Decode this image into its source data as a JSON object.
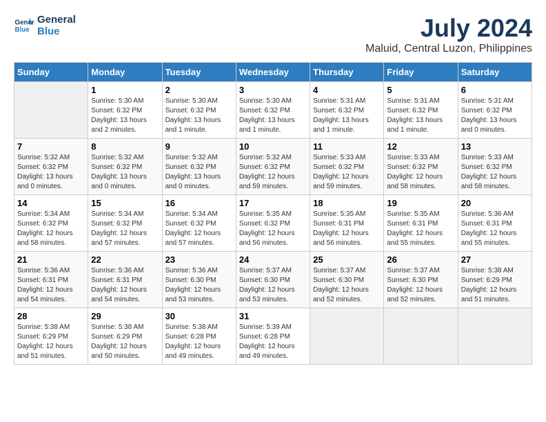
{
  "logo": {
    "line1": "General",
    "line2": "Blue"
  },
  "title": "July 2024",
  "subtitle": "Maluid, Central Luzon, Philippines",
  "days_of_week": [
    "Sunday",
    "Monday",
    "Tuesday",
    "Wednesday",
    "Thursday",
    "Friday",
    "Saturday"
  ],
  "weeks": [
    [
      {
        "day": "",
        "info": ""
      },
      {
        "day": "1",
        "info": "Sunrise: 5:30 AM\nSunset: 6:32 PM\nDaylight: 13 hours\nand 2 minutes."
      },
      {
        "day": "2",
        "info": "Sunrise: 5:30 AM\nSunset: 6:32 PM\nDaylight: 13 hours\nand 1 minute."
      },
      {
        "day": "3",
        "info": "Sunrise: 5:30 AM\nSunset: 6:32 PM\nDaylight: 13 hours\nand 1 minute."
      },
      {
        "day": "4",
        "info": "Sunrise: 5:31 AM\nSunset: 6:32 PM\nDaylight: 13 hours\nand 1 minute."
      },
      {
        "day": "5",
        "info": "Sunrise: 5:31 AM\nSunset: 6:32 PM\nDaylight: 13 hours\nand 1 minute."
      },
      {
        "day": "6",
        "info": "Sunrise: 5:31 AM\nSunset: 6:32 PM\nDaylight: 13 hours\nand 0 minutes."
      }
    ],
    [
      {
        "day": "7",
        "info": "Sunrise: 5:32 AM\nSunset: 6:32 PM\nDaylight: 13 hours\nand 0 minutes."
      },
      {
        "day": "8",
        "info": "Sunrise: 5:32 AM\nSunset: 6:32 PM\nDaylight: 13 hours\nand 0 minutes."
      },
      {
        "day": "9",
        "info": "Sunrise: 5:32 AM\nSunset: 6:32 PM\nDaylight: 13 hours\nand 0 minutes."
      },
      {
        "day": "10",
        "info": "Sunrise: 5:32 AM\nSunset: 6:32 PM\nDaylight: 12 hours\nand 59 minutes."
      },
      {
        "day": "11",
        "info": "Sunrise: 5:33 AM\nSunset: 6:32 PM\nDaylight: 12 hours\nand 59 minutes."
      },
      {
        "day": "12",
        "info": "Sunrise: 5:33 AM\nSunset: 6:32 PM\nDaylight: 12 hours\nand 58 minutes."
      },
      {
        "day": "13",
        "info": "Sunrise: 5:33 AM\nSunset: 6:32 PM\nDaylight: 12 hours\nand 58 minutes."
      }
    ],
    [
      {
        "day": "14",
        "info": "Sunrise: 5:34 AM\nSunset: 6:32 PM\nDaylight: 12 hours\nand 58 minutes."
      },
      {
        "day": "15",
        "info": "Sunrise: 5:34 AM\nSunset: 6:32 PM\nDaylight: 12 hours\nand 57 minutes."
      },
      {
        "day": "16",
        "info": "Sunrise: 5:34 AM\nSunset: 6:32 PM\nDaylight: 12 hours\nand 57 minutes."
      },
      {
        "day": "17",
        "info": "Sunrise: 5:35 AM\nSunset: 6:32 PM\nDaylight: 12 hours\nand 56 minutes."
      },
      {
        "day": "18",
        "info": "Sunrise: 5:35 AM\nSunset: 6:31 PM\nDaylight: 12 hours\nand 56 minutes."
      },
      {
        "day": "19",
        "info": "Sunrise: 5:35 AM\nSunset: 6:31 PM\nDaylight: 12 hours\nand 55 minutes."
      },
      {
        "day": "20",
        "info": "Sunrise: 5:36 AM\nSunset: 6:31 PM\nDaylight: 12 hours\nand 55 minutes."
      }
    ],
    [
      {
        "day": "21",
        "info": "Sunrise: 5:36 AM\nSunset: 6:31 PM\nDaylight: 12 hours\nand 54 minutes."
      },
      {
        "day": "22",
        "info": "Sunrise: 5:36 AM\nSunset: 6:31 PM\nDaylight: 12 hours\nand 54 minutes."
      },
      {
        "day": "23",
        "info": "Sunrise: 5:36 AM\nSunset: 6:30 PM\nDaylight: 12 hours\nand 53 minutes."
      },
      {
        "day": "24",
        "info": "Sunrise: 5:37 AM\nSunset: 6:30 PM\nDaylight: 12 hours\nand 53 minutes."
      },
      {
        "day": "25",
        "info": "Sunrise: 5:37 AM\nSunset: 6:30 PM\nDaylight: 12 hours\nand 52 minutes."
      },
      {
        "day": "26",
        "info": "Sunrise: 5:37 AM\nSunset: 6:30 PM\nDaylight: 12 hours\nand 52 minutes."
      },
      {
        "day": "27",
        "info": "Sunrise: 5:38 AM\nSunset: 6:29 PM\nDaylight: 12 hours\nand 51 minutes."
      }
    ],
    [
      {
        "day": "28",
        "info": "Sunrise: 5:38 AM\nSunset: 6:29 PM\nDaylight: 12 hours\nand 51 minutes."
      },
      {
        "day": "29",
        "info": "Sunrise: 5:38 AM\nSunset: 6:29 PM\nDaylight: 12 hours\nand 50 minutes."
      },
      {
        "day": "30",
        "info": "Sunrise: 5:38 AM\nSunset: 6:28 PM\nDaylight: 12 hours\nand 49 minutes."
      },
      {
        "day": "31",
        "info": "Sunrise: 5:39 AM\nSunset: 6:28 PM\nDaylight: 12 hours\nand 49 minutes."
      },
      {
        "day": "",
        "info": ""
      },
      {
        "day": "",
        "info": ""
      },
      {
        "day": "",
        "info": ""
      }
    ]
  ]
}
